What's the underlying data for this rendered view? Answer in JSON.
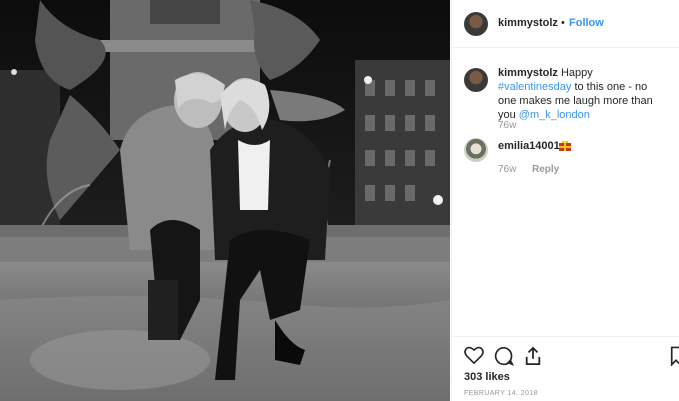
{
  "post": {
    "author": "kimmystolz",
    "separator": "•",
    "follow_label": "Follow"
  },
  "caption": {
    "username": "kimmystolz",
    "text_before": "Happy ",
    "hashtag": "#valentinesday",
    "text_mid": " to this one - no one makes me laugh more than you ",
    "mention": "@m_k_london",
    "age": "76w"
  },
  "comments": [
    {
      "username": "emilia14001",
      "emoji": "heart-gift-emoji",
      "age": "76w",
      "reply_label": "Reply"
    }
  ],
  "actions": {
    "like": "heart-icon",
    "comment": "speech-bubble-icon",
    "share": "share-icon",
    "save": "bookmark-icon"
  },
  "likes_text": "303 likes",
  "date_text": "FEBRUARY 14, 2018"
}
